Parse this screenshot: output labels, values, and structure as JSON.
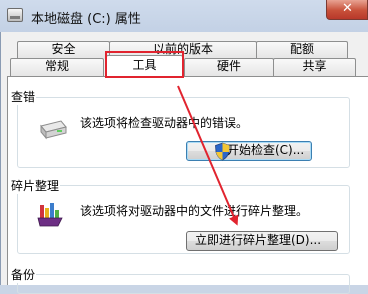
{
  "window": {
    "title": "本地磁盘 (C:) 属性",
    "close_glyph": "✕"
  },
  "tabs": {
    "row1": [
      {
        "label": "安全"
      },
      {
        "label": "以前的版本"
      },
      {
        "label": "配额"
      }
    ],
    "row2": [
      {
        "label": "常规"
      },
      {
        "label": "工具",
        "active": true
      },
      {
        "label": "硬件"
      },
      {
        "label": "共享"
      }
    ]
  },
  "sections": {
    "error_check": {
      "title": "查错",
      "description": "该选项将检查驱动器中的错误。",
      "button": "开始检查(C)...",
      "icon": "hard-drive-icon",
      "button_icon": "uac-shield-icon"
    },
    "defrag": {
      "title": "碎片整理",
      "description": "该选项将对驱动器中的文件进行碎片整理。",
      "button": "立即进行碎片整理(D)...",
      "icon": "defragment-icon"
    },
    "backup": {
      "title": "备份"
    }
  },
  "annotations": {
    "highlight_color": "#e1242f",
    "arrow_color": "#e1242f"
  }
}
